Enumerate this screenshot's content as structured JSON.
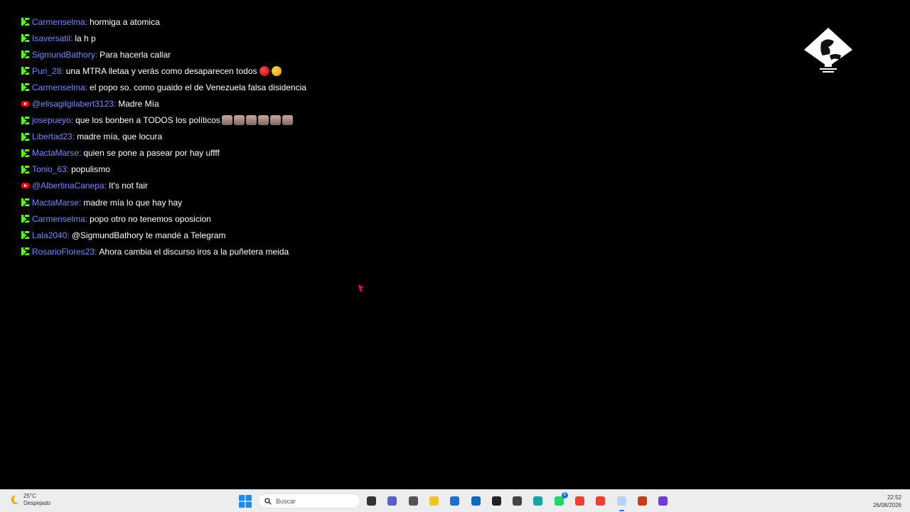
{
  "chat": {
    "messages": [
      {
        "platform": "kick",
        "user": "Carmenselma",
        "text": "hormiga a atomica",
        "emotes": []
      },
      {
        "platform": "kick",
        "user": "Isaversatil",
        "text": "la h p",
        "emotes": []
      },
      {
        "platform": "kick",
        "user": "SigmundBathory",
        "text": "Para hacerla callar",
        "emotes": []
      },
      {
        "platform": "kick",
        "user": "Puri_28",
        "text": "una MTRA lletaa y verás como desaparecen todos",
        "emotes": [
          "angry-face-emoji",
          "face-with-steam-emoji"
        ]
      },
      {
        "platform": "kick",
        "user": "Carmenselma",
        "text": "el popo so. como guaido el de Venezuela falsa disidencia",
        "emotes": []
      },
      {
        "platform": "youtube",
        "user": "@elisagilgilabert3123",
        "text": "Madre Mía",
        "emotes": []
      },
      {
        "platform": "kick",
        "user": "josepueyo",
        "text": "que los bonben a TODOS los políticos",
        "emotes": [
          "cat-emote",
          "cat-emote",
          "cat-emote",
          "cat-emote",
          "cat-emote",
          "cat-emote"
        ]
      },
      {
        "platform": "kick",
        "user": "Libertad23",
        "text": "madre mía, que locura",
        "emotes": []
      },
      {
        "platform": "kick",
        "user": "MactaMarse",
        "text": "quien se pone a pasear por hay uffff",
        "emotes": []
      },
      {
        "platform": "kick",
        "user": "Tonio_63",
        "text": "populismo",
        "emotes": []
      },
      {
        "platform": "youtube",
        "user": "@AlbertinaCanepa",
        "text": "It's not fair",
        "emotes": []
      },
      {
        "platform": "kick",
        "user": "MactaMarse",
        "text": "madre mía lo que hay hay",
        "emotes": []
      },
      {
        "platform": "kick",
        "user": "Carmenselma",
        "text": "popo otro no tenemos oposicion",
        "emotes": []
      },
      {
        "platform": "kick",
        "user": "Lala2040",
        "text": "@SigmundBathory te mandé a Telegram",
        "emotes": []
      },
      {
        "platform": "kick",
        "user": "RosarioFlores23",
        "text": "Ahora cambia el discurso iros a la puñetera meida",
        "emotes": []
      }
    ],
    "separator": ":"
  },
  "colors": {
    "username": "#7b86ff",
    "message_text": "#ffffff",
    "kick_green": "#53fc18",
    "youtube_red": "#ff0000",
    "background": "#000000"
  },
  "taskbar": {
    "weather": {
      "temperature": "25°C",
      "condition": "Despejado",
      "icon": "moon-icon"
    },
    "search_placeholder": "Buscar",
    "apps": [
      {
        "name": "task-view-icon",
        "active": false
      },
      {
        "name": "teams-icon",
        "active": false
      },
      {
        "name": "shield-app-icon",
        "active": false
      },
      {
        "name": "file-explorer-icon",
        "active": false
      },
      {
        "name": "store-icon",
        "active": false
      },
      {
        "name": "outlook-icon",
        "active": false
      },
      {
        "name": "app-red-badge-icon",
        "active": false
      },
      {
        "name": "cube-app-icon",
        "active": false
      },
      {
        "name": "edge-icon",
        "active": false
      },
      {
        "name": "whatsapp-icon",
        "active": false,
        "badge": "9"
      },
      {
        "name": "chrome-icon",
        "active": false
      },
      {
        "name": "chrome-alt-icon",
        "active": false
      },
      {
        "name": "streaming-app-icon",
        "active": true
      },
      {
        "name": "powerpoint-icon",
        "active": false
      },
      {
        "name": "circle-app-icon",
        "active": false
      }
    ],
    "clock": {
      "time": "22:52",
      "date": "26/08/2026"
    }
  }
}
